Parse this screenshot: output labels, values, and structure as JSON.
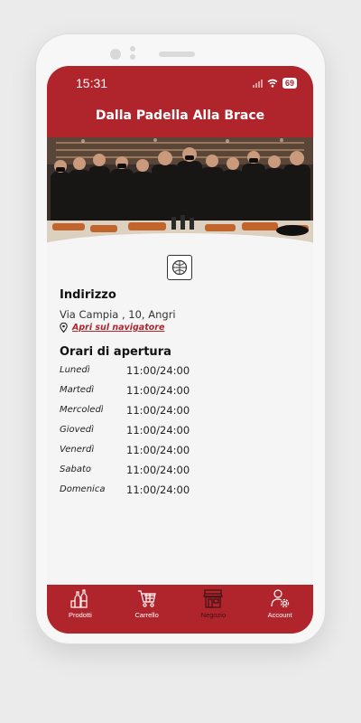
{
  "status_bar": {
    "time": "15:31",
    "battery": "69"
  },
  "header": {
    "title": "Dalla Padella Alla Brace"
  },
  "address": {
    "heading": "Indirizzo",
    "line": "Via Campia , 10, Angri",
    "navigate_link": "Apri sul navigatore"
  },
  "opening_hours": {
    "heading": "Orari di apertura",
    "rows": [
      {
        "day": "Lunedì",
        "time": "11:00/24:00"
      },
      {
        "day": "Martedì",
        "time": "11:00/24:00"
      },
      {
        "day": "Mercoledì",
        "time": "11:00/24:00"
      },
      {
        "day": "Giovedì",
        "time": "11:00/24:00"
      },
      {
        "day": "Venerdì",
        "time": "11:00/24:00"
      },
      {
        "day": "Sabato",
        "time": "11:00/24:00"
      },
      {
        "day": "Domenica",
        "time": "11:00/24:00"
      }
    ]
  },
  "tabs": [
    {
      "label": "Prodotti",
      "icon": "bottles-icon"
    },
    {
      "label": "Carrello",
      "icon": "cart-icon"
    },
    {
      "label": "Negozio",
      "icon": "store-icon",
      "active": true
    },
    {
      "label": "Account",
      "icon": "user-gear-icon"
    }
  ],
  "colors": {
    "brand_red": "#b0242c",
    "active_tab_label": "#3a1414"
  }
}
